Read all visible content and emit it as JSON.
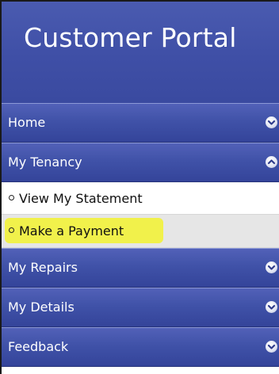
{
  "portal": {
    "title": "Customer Portal"
  },
  "menu": {
    "sections": [
      {
        "label": "Home",
        "expanded": false,
        "icon": "chevron-down-icon"
      },
      {
        "label": "My Tenancy",
        "expanded": true,
        "icon": "chevron-up-icon"
      },
      {
        "label": "My Repairs",
        "expanded": false,
        "icon": "chevron-down-icon"
      },
      {
        "label": "My Details",
        "expanded": false,
        "icon": "chevron-down-icon"
      },
      {
        "label": "Feedback",
        "expanded": false,
        "icon": "chevron-down-icon"
      }
    ],
    "tenancy_items": [
      {
        "label": "View My Statement"
      },
      {
        "label": "Make a Payment",
        "highlighted": true
      }
    ]
  },
  "colors": {
    "header_blue": "#3f4fa6",
    "menu_blue": "#4052a8",
    "highlight_yellow": "#f2f23a",
    "selected_item_bg": "#e6e6e6"
  }
}
